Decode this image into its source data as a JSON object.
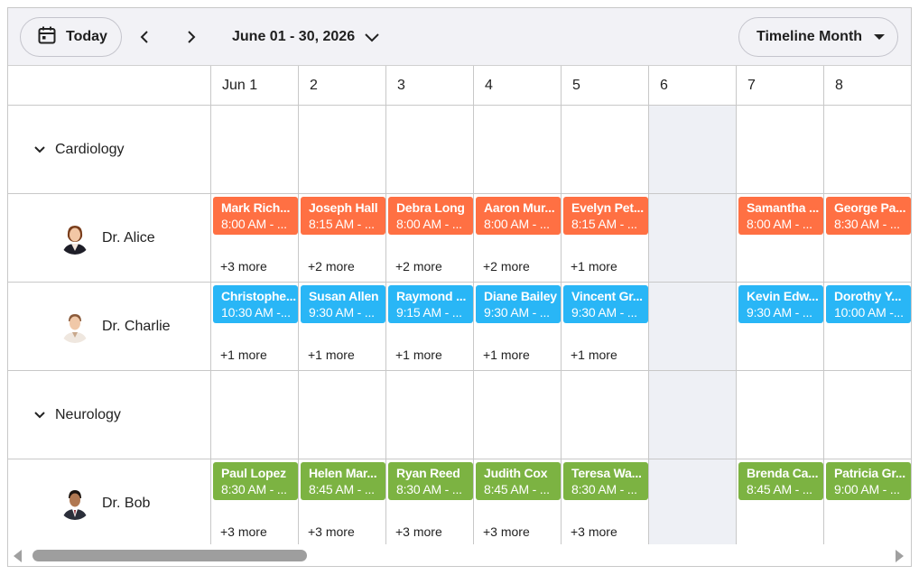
{
  "toolbar": {
    "today_label": "Today",
    "date_range": "June 01 - 30, 2026",
    "view_label": "Timeline Month",
    "icons": [
      "calendar-icon",
      "chevron-left-icon",
      "chevron-right-icon",
      "chevron-down-icon",
      "caret-down-icon"
    ]
  },
  "colors": {
    "cardiology_alice": "#ff7043",
    "cardiology_charlie": "#29b6f6",
    "neurology_bob": "#7cb342",
    "weekend": "#eef0f5",
    "scrollbar_thumb": "#9e9e9e"
  },
  "days": [
    "Jun 1",
    "2",
    "3",
    "4",
    "5",
    "6",
    "7",
    "8"
  ],
  "weekend_days": [
    "6"
  ],
  "groups": [
    {
      "name": "Cardiology",
      "doctors": [
        {
          "name": "Dr. Alice",
          "avatar": "female-doctor-avatar",
          "color": "#ff7043",
          "appointments": [
            {
              "title": "Mark Rich...",
              "time": "8:00 AM - ...",
              "more": "+3 more"
            },
            {
              "title": "Joseph Hall",
              "time": "8:15 AM - ...",
              "more": "+2 more"
            },
            {
              "title": "Debra Long",
              "time": "8:00 AM - ...",
              "more": "+2 more"
            },
            {
              "title": "Aaron Mur...",
              "time": "8:00 AM - ...",
              "more": "+2 more"
            },
            {
              "title": "Evelyn Pet...",
              "time": "8:15 AM - ...",
              "more": "+1 more"
            },
            null,
            {
              "title": "Samantha ...",
              "time": "8:00 AM - ...",
              "more": ""
            },
            {
              "title": "George Pa...",
              "time": "8:30 AM - ...",
              "more": ""
            }
          ]
        },
        {
          "name": "Dr. Charlie",
          "avatar": "male-doctor-avatar",
          "color": "#29b6f6",
          "appointments": [
            {
              "title": "Christophe...",
              "time": "10:30 AM -...",
              "more": "+1 more"
            },
            {
              "title": "Susan Allen",
              "time": "9:30 AM - ...",
              "more": "+1 more"
            },
            {
              "title": "Raymond ...",
              "time": "9:15 AM - ...",
              "more": "+1 more"
            },
            {
              "title": "Diane Bailey",
              "time": "9:30 AM - ...",
              "more": "+1 more"
            },
            {
              "title": "Vincent Gr...",
              "time": "9:30 AM - ...",
              "more": "+1 more"
            },
            null,
            {
              "title": "Kevin Edw...",
              "time": "9:30 AM - ...",
              "more": ""
            },
            {
              "title": "Dorothy Y...",
              "time": "10:00 AM -...",
              "more": ""
            }
          ]
        }
      ]
    },
    {
      "name": "Neurology",
      "doctors": [
        {
          "name": "Dr. Bob",
          "avatar": "male-doctor-suit-avatar",
          "color": "#7cb342",
          "appointments": [
            {
              "title": "Paul Lopez",
              "time": "8:30 AM - ...",
              "more": "+3 more"
            },
            {
              "title": "Helen Mar...",
              "time": "8:45 AM - ...",
              "more": "+3 more"
            },
            {
              "title": "Ryan Reed",
              "time": "8:30 AM - ...",
              "more": "+3 more"
            },
            {
              "title": "Judith Cox",
              "time": "8:45 AM - ...",
              "more": "+3 more"
            },
            {
              "title": "Teresa Wa...",
              "time": "8:30 AM - ...",
              "more": "+3 more"
            },
            null,
            {
              "title": "Brenda Ca...",
              "time": "8:45 AM - ...",
              "more": ""
            },
            {
              "title": "Patricia Gr...",
              "time": "9:00 AM - ...",
              "more": ""
            }
          ]
        }
      ]
    }
  ]
}
